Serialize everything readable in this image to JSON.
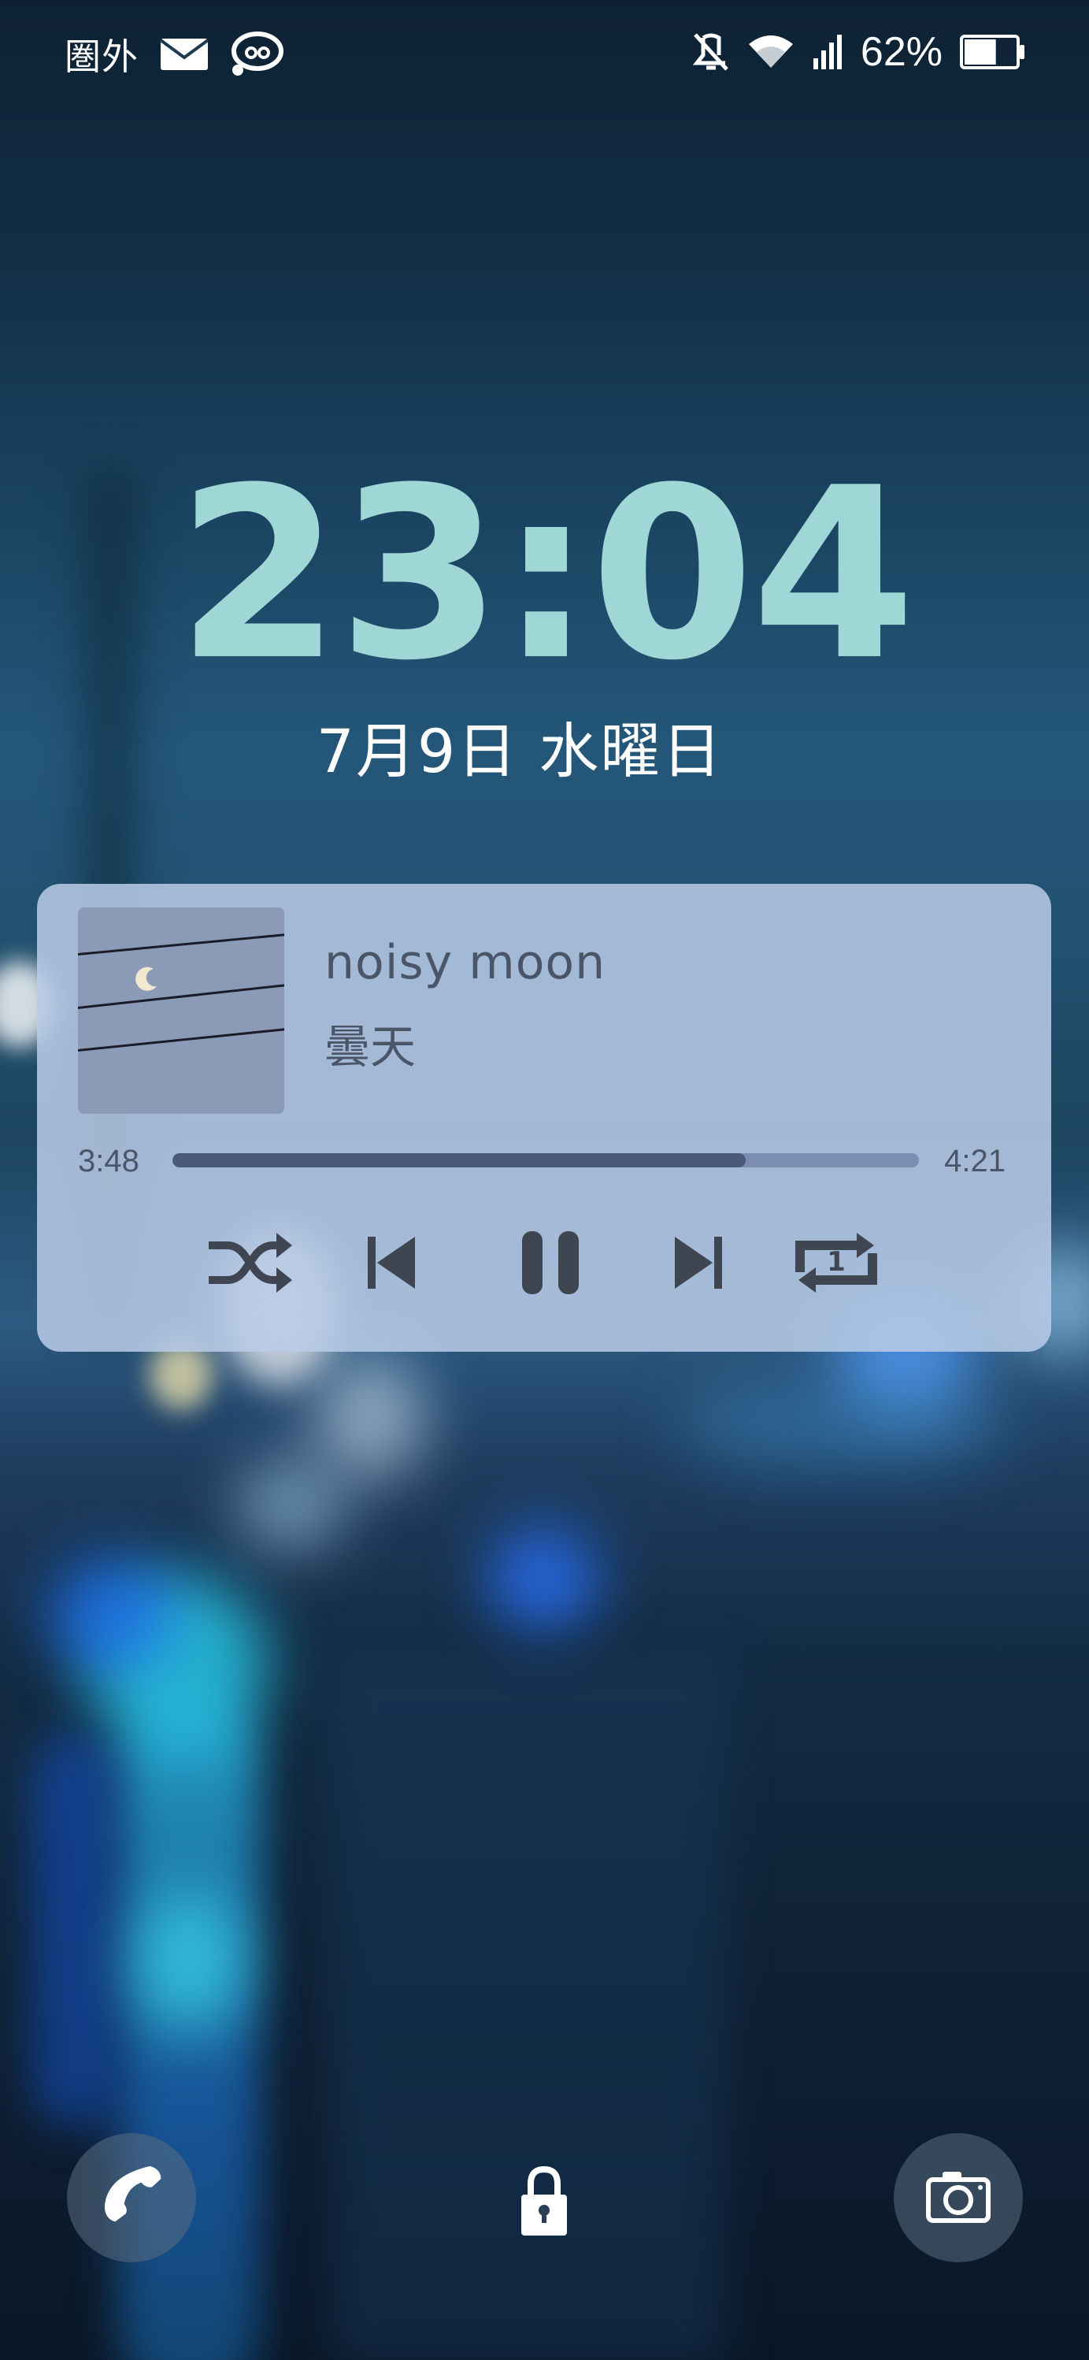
{
  "status_bar": {
    "carrier_text": "圏外",
    "icons_left": [
      "mail-icon",
      "line-app-icon"
    ],
    "icons_right": [
      "vibrate-mute-icon",
      "wifi-icon",
      "signal-icon",
      "battery-icon"
    ],
    "battery_percent": "62%",
    "battery_level": 0.62
  },
  "lockscreen": {
    "time": "23:04",
    "date": "7月9日 水曜日"
  },
  "music_player": {
    "title": "noisy moon",
    "artist": "曇天",
    "elapsed": "3:48",
    "duration": "4:21",
    "progress": 0.768,
    "controls": [
      "shuffle-icon",
      "previous-icon",
      "pause-icon",
      "next-icon",
      "repeat-one-icon"
    ],
    "colors": {
      "card": "#b9cce8",
      "text": "#4a5568",
      "progress_track": "#7b8db2",
      "progress_fill": "#4a5a7a",
      "icon": "#3f4652"
    }
  },
  "shortcuts": {
    "left": "phone-icon",
    "center": "lock-icon",
    "right": "camera-icon"
  },
  "colors": {
    "clock": "#9fd6d6"
  }
}
